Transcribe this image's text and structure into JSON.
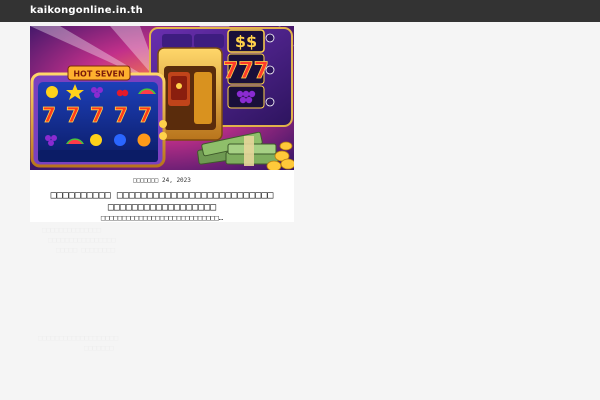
{
  "header": {
    "site_title": "kaikongonline.in.th"
  },
  "post": {
    "date": "□□□□□□□ 24, 2023",
    "title": "□□□□□□□□□□ □□□□□□□□□□□□□□□□□□□□□□□□□□□□□□□□□□□□□□□□□□□□",
    "excerpt": "□□□□□□□□□□□□□□□□□□□□□□□□□□□□…",
    "image_alt": "slot machine with hot seven reels and stacks of money"
  },
  "faint_text": {
    "line1": "□□□□□□□□□□□□□□",
    "line2": "□□□□□□□□□□□□□□□□",
    "line3": "□□□□□ □□□□□□□□",
    "line4": "□□□□□□□□□□□□□□□□□□□",
    "line5": "□□□□□□□"
  },
  "colors": {
    "topbar": "#333333",
    "background": "#f5f5f5",
    "card": "#ffffff"
  }
}
